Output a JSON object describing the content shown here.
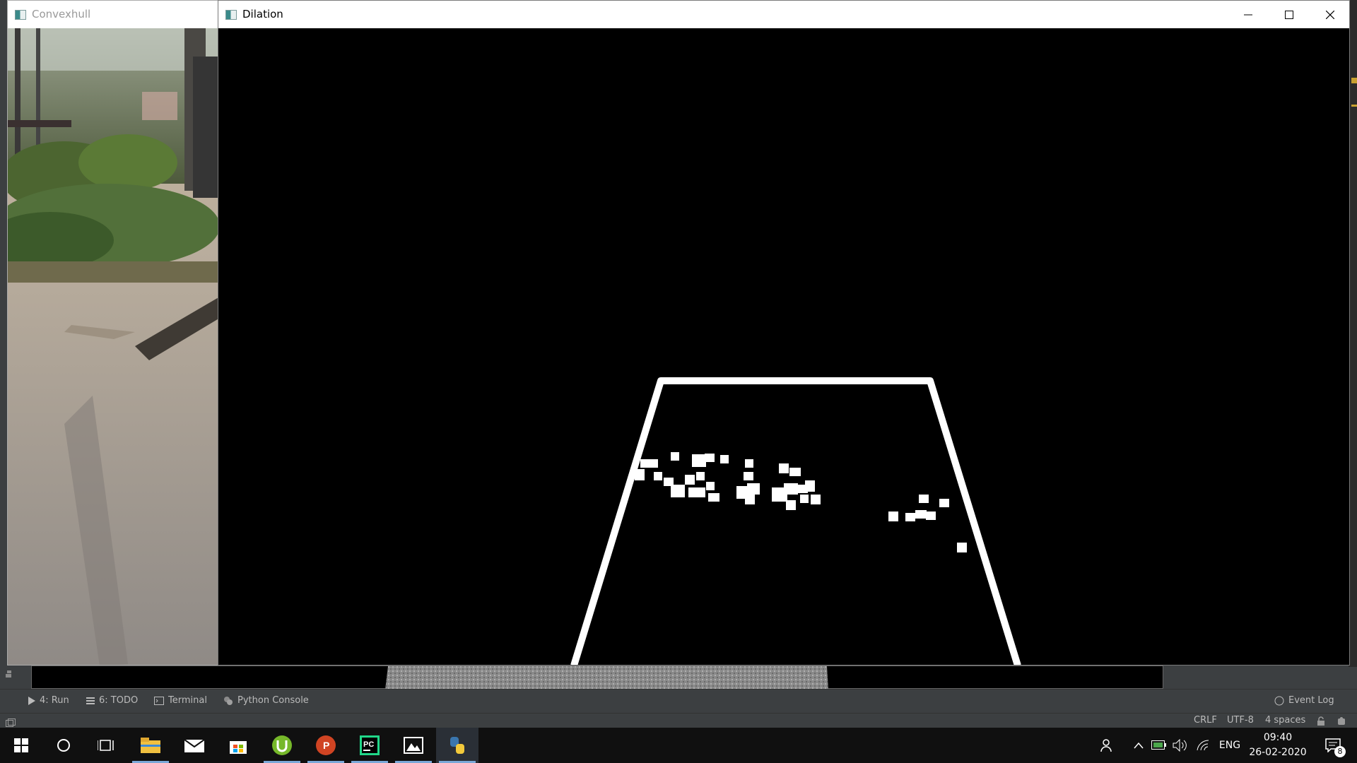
{
  "windows": {
    "convexhull": {
      "title": "Convexhull",
      "icon": "opencv-window-icon"
    },
    "dilation": {
      "title": "Dilation",
      "icon": "opencv-window-icon",
      "controls": [
        "minimize-icon",
        "maximize-icon",
        "close-icon"
      ]
    }
  },
  "ide": {
    "tool_tabs": [
      {
        "label": "4: Run",
        "icon": "play-icon"
      },
      {
        "label": "6: TODO",
        "icon": "list-icon"
      },
      {
        "label": "Terminal",
        "icon": "terminal-icon"
      },
      {
        "label": "Python Console",
        "icon": "python-icon"
      }
    ],
    "event_log": "Event Log",
    "status": {
      "line_sep": "CRLF",
      "encoding": "UTF-8",
      "indent": "4 spaces"
    }
  },
  "taskbar": {
    "apps": [
      "windows-start-icon",
      "cortana-icon",
      "task-view-icon",
      "file-explorer-icon",
      "mail-icon",
      "store-icon",
      "utorrent-icon",
      "powerpoint-icon",
      "pycharm-icon",
      "photos-icon",
      "python-icon"
    ],
    "language": "ENG",
    "time": "09:40",
    "date": "26-02-2020",
    "notification_count": "8"
  },
  "colors": {
    "ide_bg": "#3c3f41",
    "taskbar_bg": "#101010",
    "marker": "#c8a030"
  }
}
